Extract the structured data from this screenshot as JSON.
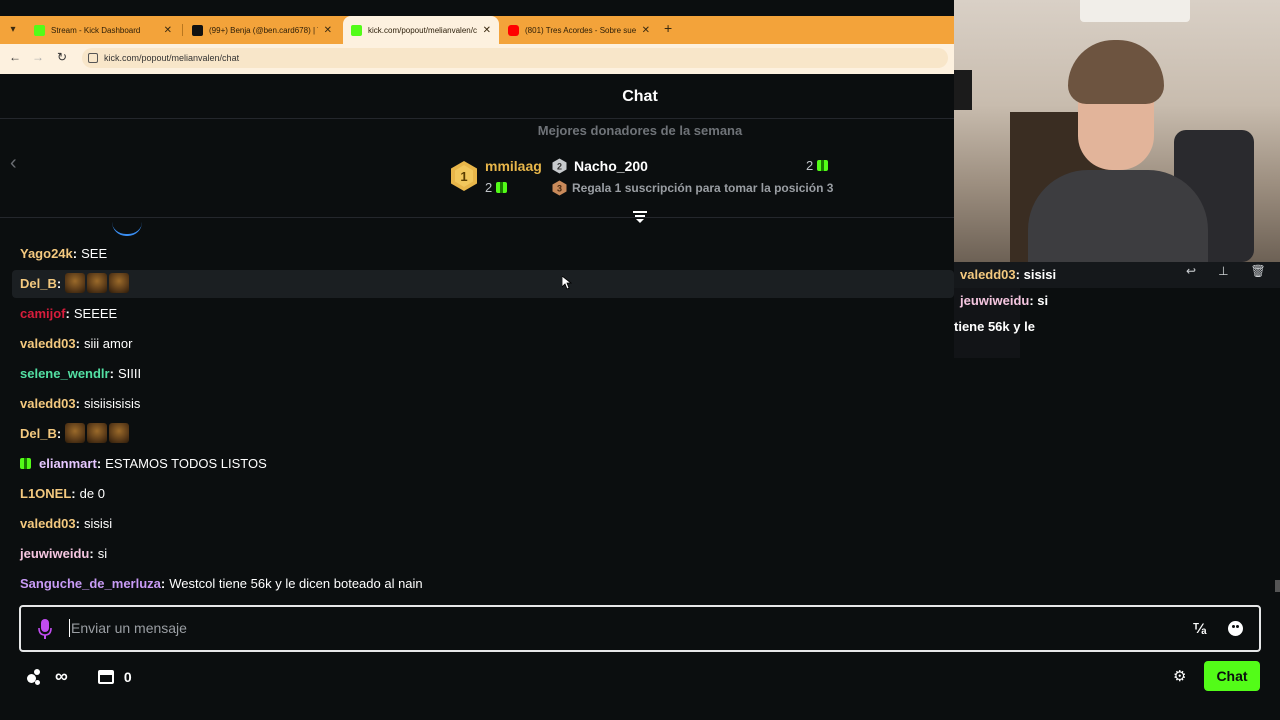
{
  "browser": {
    "tabs": [
      {
        "title": "Stream - Kick Dashboard",
        "favicon_color": "#53fc18"
      },
      {
        "title": "(99+) Benja (@ben.card678) | Ti",
        "favicon_color": "#111111"
      },
      {
        "title": "kick.com/popout/melianvalen/c",
        "favicon_color": "#53fc18",
        "active": true
      },
      {
        "title": "(801) Tres Acordes - Sobre sue",
        "favicon_color": "#ff0000"
      }
    ],
    "url": "kick.com/popout/melianvalen/chat"
  },
  "chat": {
    "title": "Chat",
    "donors_title": "Mejores donadores de la semana",
    "donor1": {
      "name": "mmilaag",
      "count": "2",
      "rank": "1"
    },
    "donor2": {
      "name": "Nacho_200",
      "count": "2",
      "rank": "2"
    },
    "donor3": {
      "text": "Regala 1 suscripción para tomar la posición 3",
      "rank": "3"
    },
    "messages": [
      {
        "user": "Yago24k",
        "color": "#f4c97f",
        "text": "SEE"
      },
      {
        "user": "Del_B",
        "color": "#f4c97f",
        "text": "",
        "emotes": 3
      },
      {
        "user": "camijof",
        "color": "#d81d3c",
        "text": "SEEEE"
      },
      {
        "user": "valedd03",
        "color": "#f4c97f",
        "text": "siii amor"
      },
      {
        "user": "selene_wendlr",
        "color": "#53e0a3",
        "text": "SIIII"
      },
      {
        "user": "valedd03",
        "color": "#f4c97f",
        "text": "sisiisisisis"
      },
      {
        "user": "Del_B",
        "color": "#f4c97f",
        "text": "",
        "emotes": 3
      },
      {
        "user": "elianmart",
        "color": "#e6c8ff",
        "text": "ESTAMOS TODOS LISTOS",
        "gift_badge": true
      },
      {
        "user": "L1ONEL",
        "color": "#f4c97f",
        "text": "de 0"
      },
      {
        "user": "valedd03",
        "color": "#f4c97f",
        "text": "sisisi"
      },
      {
        "user": "jeuwiweidu",
        "color": "#f5c6e0",
        "text": "si"
      },
      {
        "user": "Sanguche_de_merluza",
        "color": "#c89bf5",
        "text": "Westcol tiene 56k y le dicen boteado al nain"
      }
    ],
    "input_placeholder": "Enviar un mensaje",
    "points_value": "0",
    "chat_button": "Chat"
  },
  "overlay": {
    "lines": [
      {
        "user": "valedd03",
        "color": "#f4c97f",
        "text": ": sisisi"
      },
      {
        "user": "jeuwiweidu",
        "color": "#f5c6e0",
        "text": ": si"
      },
      {
        "user": "",
        "color": "#ffffff",
        "text": "tiene 56k y le"
      }
    ]
  }
}
